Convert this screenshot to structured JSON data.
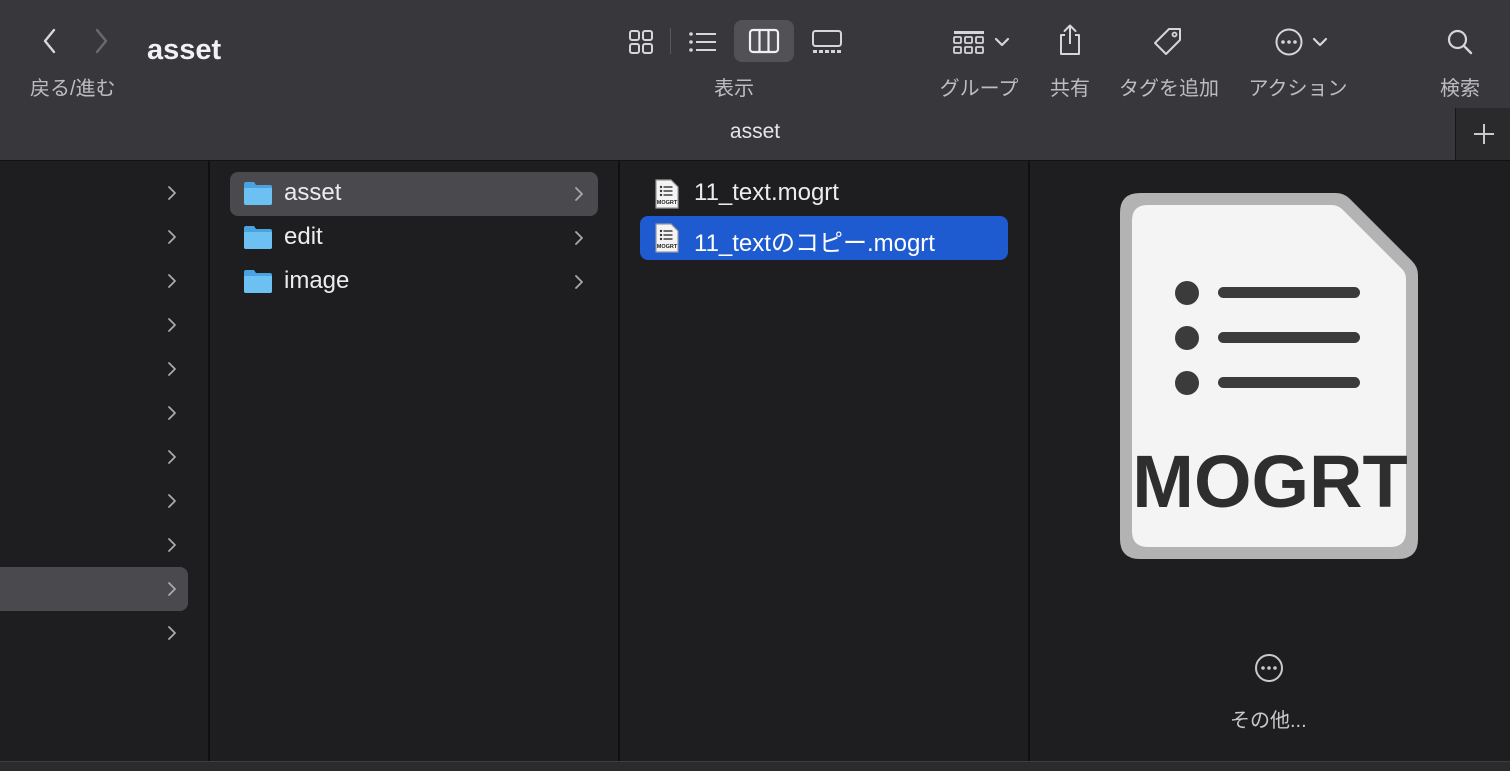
{
  "toolbar": {
    "folder_title": "asset",
    "nav_label": "戻る/進む",
    "view_label": "表示",
    "group_label": "グループ",
    "share_label": "共有",
    "tag_label": "タグを追加",
    "action_label": "アクション",
    "search_label": "検索"
  },
  "tab": {
    "title": "asset"
  },
  "sidebar_column": {
    "row_count": 11,
    "selected_index": 9
  },
  "folders": [
    {
      "name": "asset",
      "selected": true
    },
    {
      "name": "edit",
      "selected": false
    },
    {
      "name": "image",
      "selected": false
    }
  ],
  "files": [
    {
      "name": "11_text.mogrt",
      "selected": false
    },
    {
      "name": "11_textのコピー.mogrt",
      "selected": true
    }
  ],
  "preview": {
    "icon_text": "MOGRT",
    "more_label": "その他..."
  },
  "colors": {
    "selection_blue": "#1f5bd0",
    "folder_blue": "#5fb5ec",
    "window_bg": "#1e1e21",
    "toolbar_bg": "#38383c"
  }
}
